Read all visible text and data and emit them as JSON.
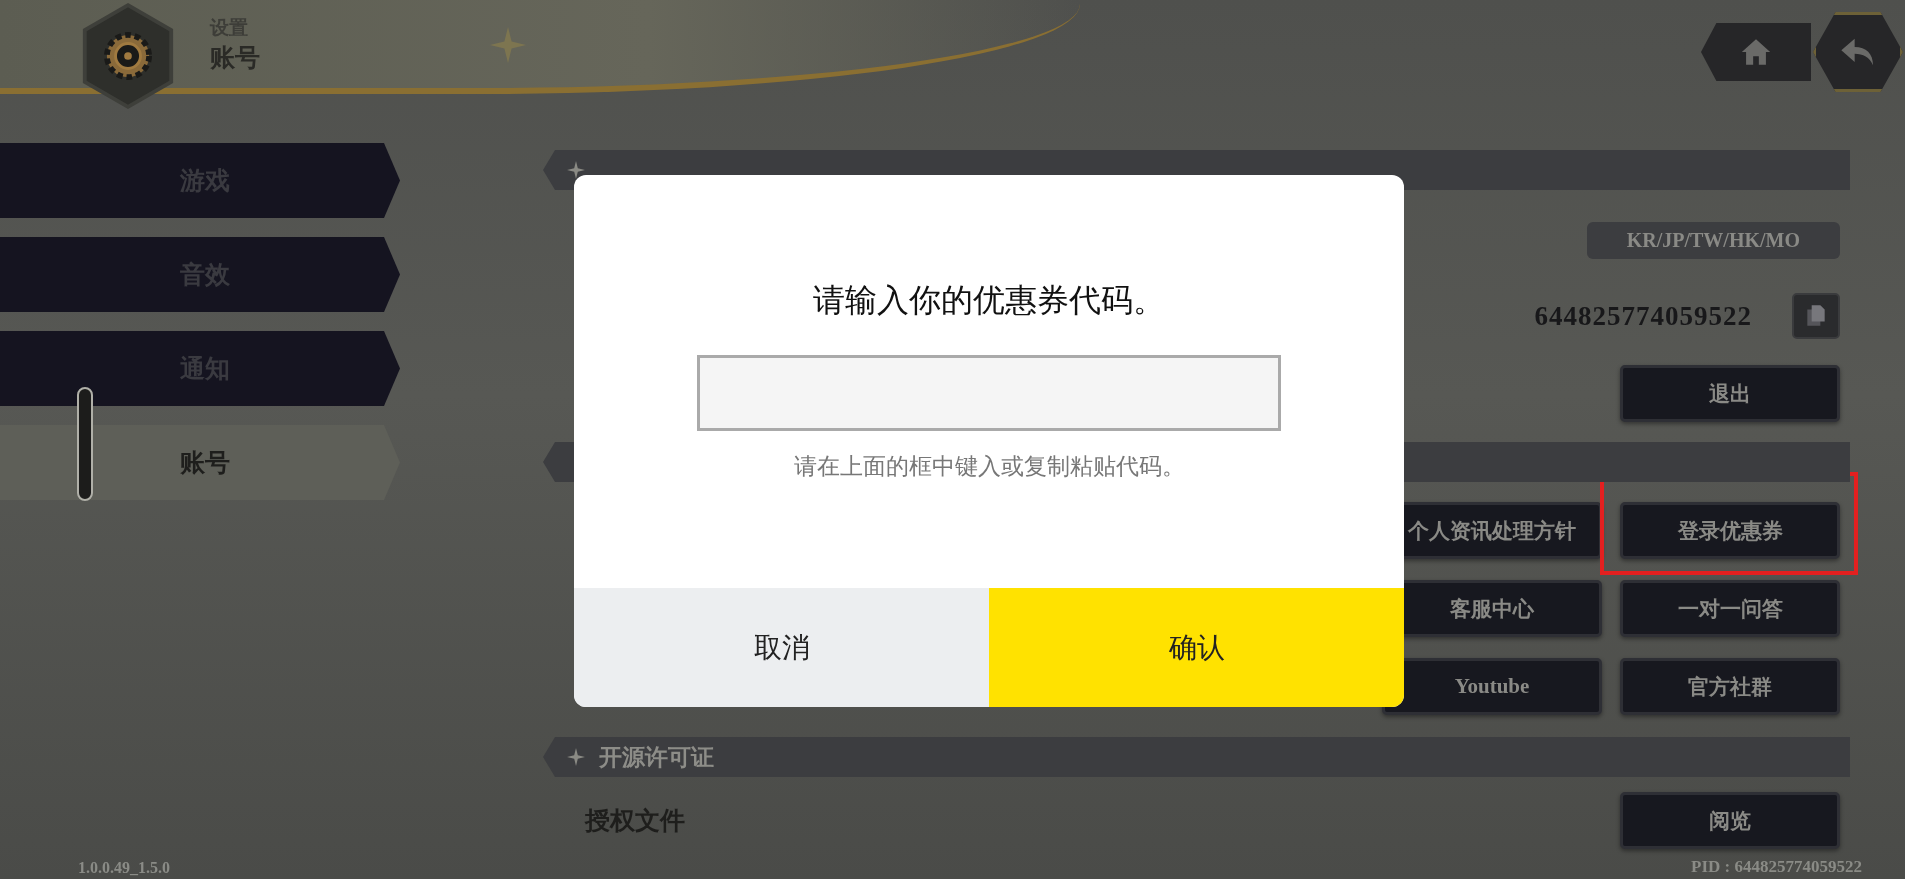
{
  "header": {
    "section": "设置",
    "page": "账号"
  },
  "sidebar": {
    "items": [
      {
        "label": "游戏",
        "selected": false
      },
      {
        "label": "音效",
        "selected": false
      },
      {
        "label": "通知",
        "selected": false
      },
      {
        "label": "账号",
        "selected": true
      }
    ]
  },
  "account": {
    "region": "KR/JP/TW/HK/MO",
    "user_id": "644825774059522",
    "logout": "退出"
  },
  "links": {
    "buttons": [
      {
        "label": "个人资讯处理方针",
        "highlighted": false
      },
      {
        "label": "登录优惠券",
        "highlighted": true
      },
      {
        "label": "客服中心",
        "highlighted": false
      },
      {
        "label": "一对一问答",
        "highlighted": false
      },
      {
        "label": "Youtube",
        "highlighted": false
      },
      {
        "label": "官方社群",
        "highlighted": false
      }
    ]
  },
  "license": {
    "title": "开源许可证",
    "row_label": "授权文件",
    "button": "阅览"
  },
  "footer": {
    "version": "1.0.0.49_1.5.0",
    "pid": "PID : 644825774059522"
  },
  "dialog": {
    "title": "请输入你的优惠券代码。",
    "hint": "请在上面的框中键入或复制粘贴代码。",
    "cancel": "取消",
    "confirm": "确认"
  }
}
